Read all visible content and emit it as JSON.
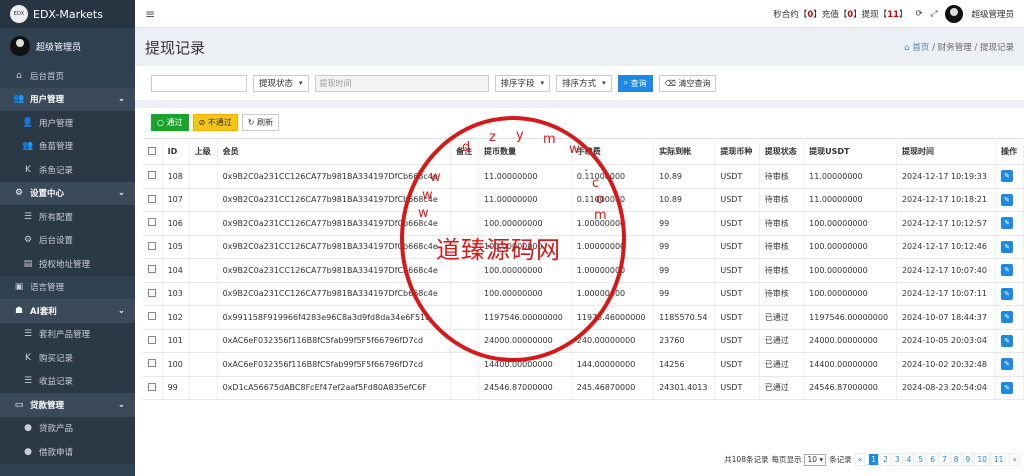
{
  "app": {
    "brand": "EDX-Markets",
    "logo_text": "EDX",
    "user": "超级管理员"
  },
  "sidebar": {
    "items": [
      {
        "label": "后台首页",
        "icon": "home-icon",
        "glyph": "⌂",
        "type": "top"
      },
      {
        "label": "用户管理",
        "icon": "users-icon",
        "glyph": "👥",
        "type": "grp"
      },
      {
        "label": "用户管理",
        "icon": "user-icon",
        "glyph": "👤",
        "type": "sub"
      },
      {
        "label": "鱼苗管理",
        "icon": "group-icon",
        "glyph": "👥",
        "type": "sub"
      },
      {
        "label": "杀鱼记录",
        "icon": "k-icon",
        "glyph": "K",
        "type": "sub"
      },
      {
        "label": "设置中心",
        "icon": "gears-icon",
        "glyph": "⚙",
        "type": "grp"
      },
      {
        "label": "所有配置",
        "icon": "list-icon",
        "glyph": "☰",
        "type": "sub"
      },
      {
        "label": "后台设置",
        "icon": "gear-icon",
        "glyph": "⚙",
        "type": "sub"
      },
      {
        "label": "授权地址管理",
        "icon": "doc-icon",
        "glyph": "▤",
        "type": "sub"
      },
      {
        "label": "语言管理",
        "icon": "language-icon",
        "glyph": "▣",
        "type": "top"
      },
      {
        "label": "AI套利",
        "icon": "robot-icon",
        "glyph": "☗",
        "type": "grp"
      },
      {
        "label": "套利产品管理",
        "icon": "list-icon",
        "glyph": "☰",
        "type": "sub"
      },
      {
        "label": "购买记录",
        "icon": "k-icon",
        "glyph": "K",
        "type": "sub"
      },
      {
        "label": "收益记录",
        "icon": "list-icon",
        "glyph": "☰",
        "type": "sub"
      },
      {
        "label": "贷款管理",
        "icon": "money-icon",
        "glyph": "▭",
        "type": "grp"
      },
      {
        "label": "贷款产品",
        "icon": "coin-icon",
        "glyph": "●",
        "type": "sub"
      },
      {
        "label": "借款申请",
        "icon": "coin-icon",
        "glyph": "●",
        "type": "sub"
      }
    ]
  },
  "topbar": {
    "t1": "秒合约【",
    "n1": "0",
    "t2": "】充值【",
    "n2": "0",
    "t3": "】提现【",
    "n3": "11",
    "t4": "】",
    "user": "超级管理员"
  },
  "header": {
    "title": "提现记录",
    "crumb_home": "首页",
    "crumb_sep": "/",
    "crumb2": "财务管理",
    "crumb3": "提现记录"
  },
  "filters": {
    "input_value": "",
    "status": "提现状态",
    "time_placeholder": "提现时间",
    "sort_field": "排序字段",
    "sort_mode": "排序方式",
    "query": "查询",
    "clear": "清空查询"
  },
  "toolbar": {
    "pass": "通过",
    "reject": "不通过",
    "refresh": "刷新"
  },
  "table": {
    "headers": [
      "ID",
      "上级",
      "会员",
      "备注",
      "提币数量",
      "手续费",
      "实际到帐",
      "提现币种",
      "提现状态",
      "提现USDT",
      "提现时间",
      "操作"
    ],
    "rows": [
      [
        "108",
        "",
        "0x9B2C0a231CC126CA77b981BA334197DfCb668c4e",
        "",
        "11.00000000",
        "0.11000000",
        "10.89",
        "USDT",
        "待审核",
        "11.00000000",
        "2024-12-17 10:19:33"
      ],
      [
        "107",
        "",
        "0x9B2C0a231CC126CA77b981BA334197DfCb668c4e",
        "",
        "11.00000000",
        "0.11000000",
        "10.89",
        "USDT",
        "待审核",
        "11.00000000",
        "2024-12-17 10:18:21"
      ],
      [
        "106",
        "",
        "0x9B2C0a231CC126CA77b981BA334197DfCb668c4e",
        "",
        "100.00000000",
        "1.00000000",
        "99",
        "USDT",
        "待审核",
        "100.00000000",
        "2024-12-17 10:12:57"
      ],
      [
        "105",
        "",
        "0x9B2C0a231CC126CA77b981BA334197DfCb668c4e",
        "",
        "100.00000000",
        "1.00000000",
        "99",
        "USDT",
        "待审核",
        "100.00000000",
        "2024-12-17 10:12:46"
      ],
      [
        "104",
        "",
        "0x9B2C0a231CC126CA77b981BA334197DfCb668c4e",
        "",
        "100.00000000",
        "1.00000000",
        "99",
        "USDT",
        "待审核",
        "100.00000000",
        "2024-12-17 10:07:40"
      ],
      [
        "103",
        "",
        "0x9B2C0a231CC126CA77b981BA334197DfCb668c4e",
        "",
        "100.00000000",
        "1.00000000",
        "99",
        "USDT",
        "待审核",
        "100.00000000",
        "2024-12-17 10:07:11"
      ],
      [
        "102",
        "",
        "0x991158F919966f4283e96C8a3d9fd8da34e6F510",
        "",
        "1197546.00000000",
        "11975.46000000",
        "1185570.54",
        "USDT",
        "已通过",
        "1197546.00000000",
        "2024-10-07 18:44:37"
      ],
      [
        "101",
        "",
        "0xAC6eF032356f116B8fC5fab99f5F5f66796fD7cd",
        "",
        "24000.00000000",
        "240.00000000",
        "23760",
        "USDT",
        "已通过",
        "24000.00000000",
        "2024-10-05 20:03:04"
      ],
      [
        "100",
        "",
        "0xAC6eF032356f116B8fC5fab99f5F5f66796fD7cd",
        "",
        "14400.00000000",
        "144.00000000",
        "14256",
        "USDT",
        "已通过",
        "14400.00000000",
        "2024-10-02 20:32:48"
      ],
      [
        "99",
        "",
        "0xD1cA56675dABC8FcEf47ef2aaf5Fd80A835efC6F",
        "",
        "24546.87000000",
        "245.46870000",
        "24301.4013",
        "USDT",
        "已通过",
        "24546.87000000",
        "2024-08-23 20:54:04"
      ]
    ]
  },
  "pager": {
    "total": "共108条记录",
    "per_label": "每页显示",
    "per": "10",
    "unit": "条记录",
    "prev": "«",
    "pages": [
      "1",
      "2",
      "3",
      "4",
      "5",
      "6",
      "7",
      "8",
      "9",
      "10",
      "11"
    ],
    "next": "»"
  },
  "watermark": {
    "text": "道臻源码网",
    "chars": [
      "d",
      "z",
      "y",
      "m",
      "w",
      ".",
      "c",
      "o",
      "m",
      "w",
      "w",
      "w"
    ]
  }
}
